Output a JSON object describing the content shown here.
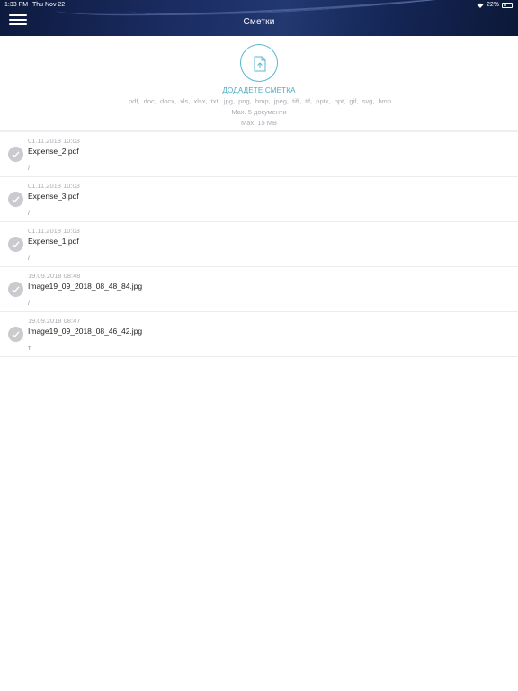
{
  "status_bar": {
    "time": "1:33 PM",
    "date": "Thu Nov 22",
    "battery": "22%"
  },
  "header": {
    "title": "Сметки"
  },
  "upload": {
    "title": "ДОДАДЕТЕ СМЕТКА",
    "formats": ".pdf, .doc, .docx, .xls, .xlsx, .txt, .jpg, .png, .bmp, .jpeg, .tiff, .tif, .pptx, .ppt, .gif, .svg, .bmp",
    "max_docs": "Max. 5 документи",
    "max_size": "Max. 15 MB"
  },
  "files": [
    {
      "date": "01.11.2018 10:03",
      "name": "Expense_2.pdf",
      "note": "/"
    },
    {
      "date": "01.11.2018 10:03",
      "name": "Expense_3.pdf",
      "note": "/"
    },
    {
      "date": "01.11.2018 10:03",
      "name": "Expense_1.pdf",
      "note": "/"
    },
    {
      "date": "19.09.2018 08:48",
      "name": "Image19_09_2018_08_48_84.jpg",
      "note": "/"
    },
    {
      "date": "19.09.2018 08:47",
      "name": "Image19_09_2018_08_46_42.jpg",
      "note": "т"
    }
  ],
  "colors": {
    "accent": "#4aaac6",
    "header_bg": "#1b2d63",
    "check_bg": "#c9cbcf"
  },
  "icons": {
    "menu": "hamburger-menu-icon",
    "upload": "upload-document-icon",
    "status": "checkmark-icon"
  }
}
